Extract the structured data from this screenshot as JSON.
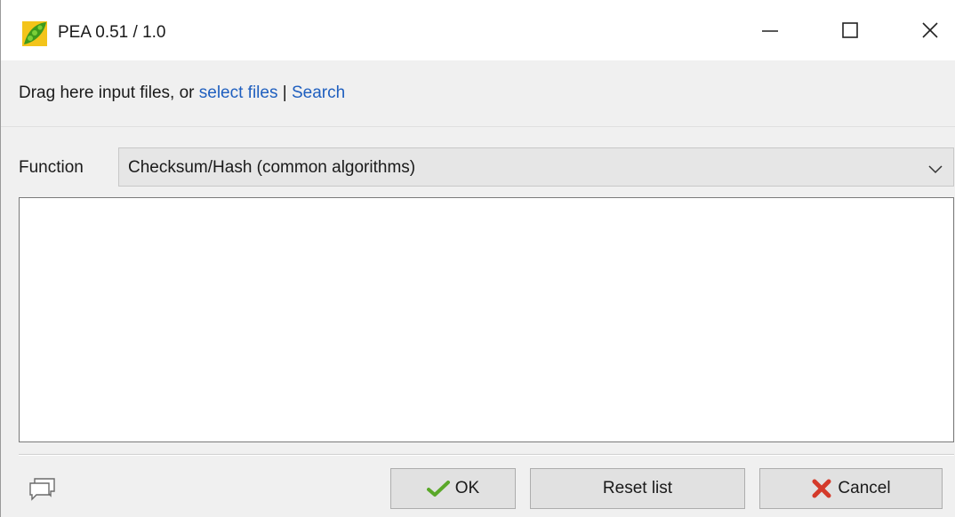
{
  "window": {
    "title": "PEA 0.51 / 1.0",
    "app_icon": "pea-pod-icon",
    "controls": [
      "minimize-icon",
      "maximize-icon",
      "close-icon"
    ]
  },
  "dropbar": {
    "prefix": "Drag here input files, or ",
    "select_files_link": "select files",
    "separator": " | ",
    "search_link": "Search"
  },
  "function": {
    "label": "Function",
    "selected": "Checksum/Hash (common algorithms)"
  },
  "input_list": {
    "items": []
  },
  "footer": {
    "chat_icon": "speech-bubbles-icon",
    "ok_label": "OK",
    "reset_label": "Reset list",
    "cancel_label": "Cancel"
  },
  "colors": {
    "link": "#1f5fbf",
    "ok_check": "#5aa829",
    "cancel_x": "#d43a2a"
  }
}
